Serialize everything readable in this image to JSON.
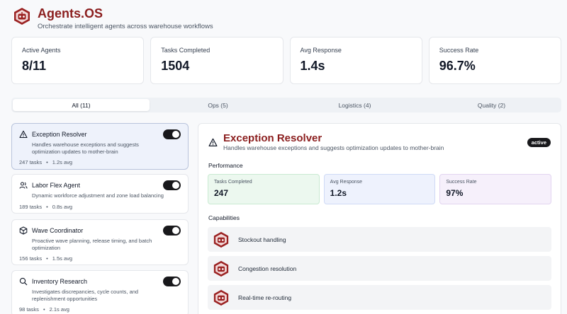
{
  "app": {
    "title": "Agents.OS",
    "subtitle": "Orchestrate intelligent agents across warehouse workflows",
    "brand_color": "#8b1e1e"
  },
  "stats": [
    {
      "label": "Active Agents",
      "value": "8/11"
    },
    {
      "label": "Tasks Completed",
      "value": "1504"
    },
    {
      "label": "Avg Response",
      "value": "1.4s"
    },
    {
      "label": "Success Rate",
      "value": "96.7%"
    }
  ],
  "tabs": [
    {
      "label": "All (11)",
      "active": true
    },
    {
      "label": "Ops (5)",
      "active": false
    },
    {
      "label": "Logistics (4)",
      "active": false
    },
    {
      "label": "Quality (2)",
      "active": false
    }
  ],
  "agents": [
    {
      "name": "Exception Resolver",
      "icon": "warning-triangle-icon",
      "description": "Handles warehouse exceptions and suggests optimization updates to mother-brain",
      "tasks": "247 tasks",
      "avg": "1.2s avg",
      "enabled": true,
      "selected": true
    },
    {
      "name": "Labor Flex Agent",
      "icon": "users-icon",
      "description": "Dynamic workforce adjustment and zone load balancing",
      "tasks": "189 tasks",
      "avg": "0.8s avg",
      "enabled": true,
      "selected": false
    },
    {
      "name": "Wave Coordinator",
      "icon": "box-icon",
      "description": "Proactive wave planning, release timing, and batch optimization",
      "tasks": "156 tasks",
      "avg": "1.5s avg",
      "enabled": true,
      "selected": false
    },
    {
      "name": "Inventory Research",
      "icon": "search-icon",
      "description": "Investigates discrepancies, cycle counts, and replenishment opportunities",
      "tasks": "98 tasks",
      "avg": "2.1s avg",
      "enabled": true,
      "selected": false
    }
  ],
  "detail": {
    "name": "Exception Resolver",
    "description": "Handles warehouse exceptions and suggests optimization updates to mother-brain",
    "status": "active",
    "performance_title": "Performance",
    "performance": [
      {
        "label": "Tasks Completed",
        "value": "247",
        "color": "#ecf8ef"
      },
      {
        "label": "Avg Response",
        "value": "1.2s",
        "color": "#eef2fd"
      },
      {
        "label": "Success Rate",
        "value": "97%",
        "color": "#f6f0fb"
      }
    ],
    "capabilities_title": "Capabilities",
    "capabilities": [
      {
        "label": "Stockout handling",
        "icon": "robot-badge-icon"
      },
      {
        "label": "Congestion resolution",
        "icon": "robot-badge-icon"
      },
      {
        "label": "Real-time re-routing",
        "icon": "robot-badge-icon"
      }
    ]
  }
}
